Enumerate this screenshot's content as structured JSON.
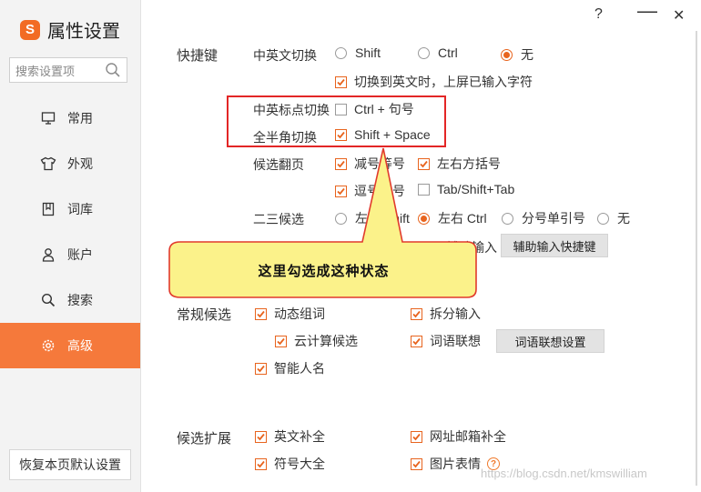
{
  "app": {
    "logo": "S",
    "title": "属性设置"
  },
  "window_controls": {
    "help": "?",
    "minimize": "—",
    "close": "✕"
  },
  "search": {
    "placeholder": "搜索设置项",
    "icon": "search-icon"
  },
  "nav": [
    {
      "label": "常用",
      "icon": "monitor-icon"
    },
    {
      "label": "外观",
      "icon": "shirt-icon"
    },
    {
      "label": "词库",
      "icon": "book-icon"
    },
    {
      "label": "账户",
      "icon": "user-icon"
    },
    {
      "label": "搜索",
      "icon": "search-icon"
    },
    {
      "label": "高级",
      "icon": "gear-icon",
      "active": true
    }
  ],
  "restore_button": "恢复本页默认设置",
  "shortcuts": {
    "section_label": "快捷键",
    "cn_en_switch": {
      "label": "中英文切换",
      "options": [
        "Shift",
        "Ctrl",
        "无"
      ],
      "selected": "无"
    },
    "cn_en_switch_commit": {
      "label": "切换到英文时，上屏已输入字符",
      "checked": true
    },
    "punct_switch": {
      "label": "中英标点切换",
      "option": "Ctrl + 句号",
      "checked": false
    },
    "fullwidth_switch": {
      "label": "全半角切换",
      "option": "Shift + Space",
      "checked": true
    },
    "page_flip": {
      "label": "候选翻页",
      "options": [
        {
          "text": "减号等号",
          "checked": true
        },
        {
          "text": "左右方括号",
          "checked": true
        },
        {
          "text": "逗号句号",
          "checked": true
        },
        {
          "text": "Tab/Shift+Tab",
          "checked": false
        }
      ]
    },
    "second_third": {
      "label": "二三候选",
      "options": [
        "左右 Shift",
        "左右 Ctrl",
        "分号单引号",
        "无"
      ],
      "selected": "左右 Ctrl"
    },
    "aux_input_text": "辅助输入",
    "aux_input_button": "辅助输入快捷键"
  },
  "callout": {
    "text": "这里勾选成这种状态"
  },
  "regular_candidates": {
    "section_label": "常规候选",
    "items": [
      {
        "text": "动态组词",
        "checked": true
      },
      {
        "text": "拆分输入",
        "checked": true
      },
      {
        "text": "云计算候选",
        "checked": true
      },
      {
        "text": "词语联想",
        "checked": true
      },
      {
        "text": "智能人名",
        "checked": true
      }
    ],
    "association_button": "词语联想设置"
  },
  "candidate_extension": {
    "section_label": "候选扩展",
    "items": [
      {
        "text": "英文补全",
        "checked": true
      },
      {
        "text": "网址邮箱补全",
        "checked": true
      },
      {
        "text": "符号大全",
        "checked": true
      },
      {
        "text": "图片表情",
        "checked": true
      }
    ],
    "help_icon": "?"
  },
  "colors": {
    "accent": "#f5793b",
    "check": "#e8641e",
    "highlight_border": "#e32626",
    "callout_fill": "#fbf28a"
  },
  "watermark": "https://blog.csdn.net/kmswilliam"
}
